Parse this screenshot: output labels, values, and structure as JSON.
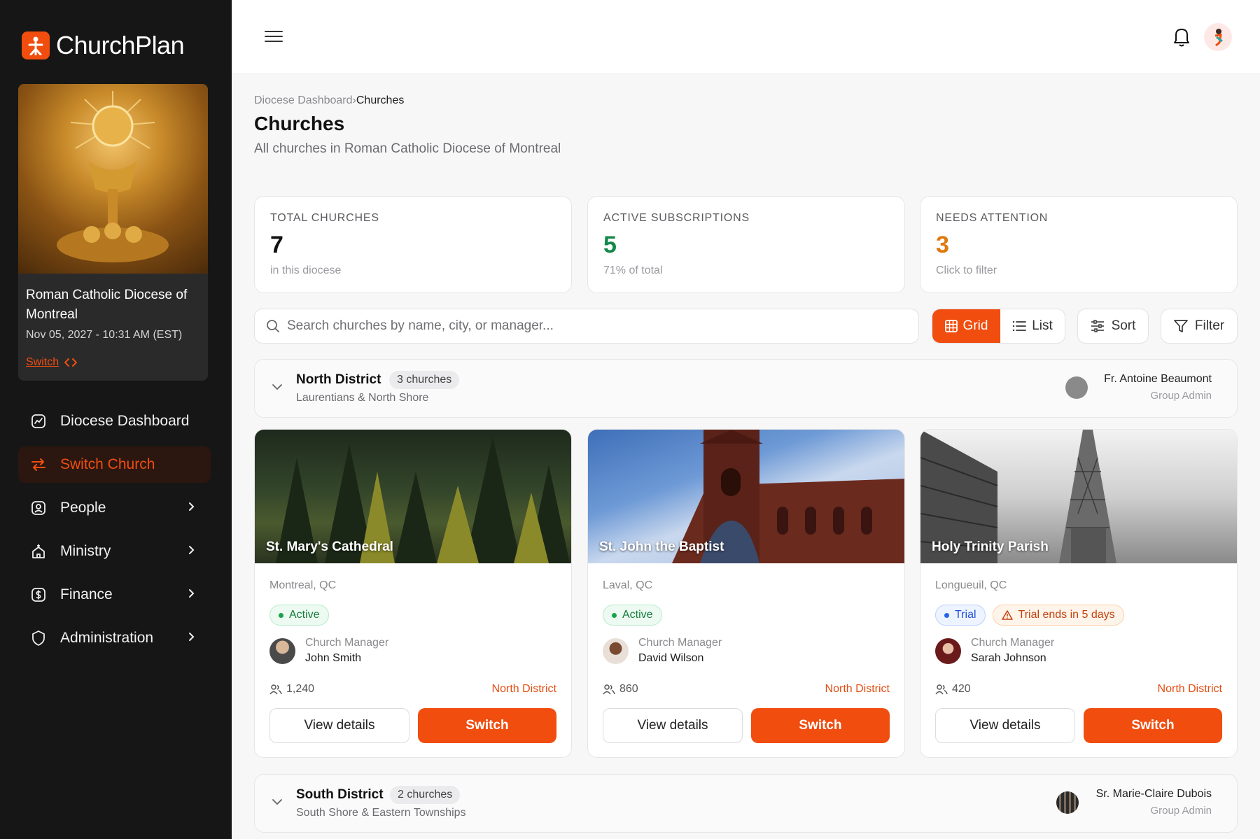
{
  "app": {
    "name": "ChurchPlan"
  },
  "diocese": {
    "name": "Roman Catholic Diocese of Montreal",
    "datetime": "Nov 05, 2027 - 10:31 AM (EST)",
    "switch_label": "Switch"
  },
  "nav": {
    "items": [
      {
        "label": "Diocese Dashboard",
        "icon": "chart-icon"
      },
      {
        "label": "Switch Church",
        "icon": "swap-icon",
        "active": true
      },
      {
        "label": "People",
        "icon": "user-icon"
      },
      {
        "label": "Ministry",
        "icon": "church-icon"
      },
      {
        "label": "Finance",
        "icon": "dollar-icon"
      },
      {
        "label": "Administration",
        "icon": "shield-icon"
      }
    ]
  },
  "breadcrumb": {
    "parent": "Diocese Dashboard",
    "separator": "›",
    "current": "Churches"
  },
  "page": {
    "title": "Churches",
    "subtitle": "All churches in Roman Catholic Diocese of Montreal"
  },
  "stats": [
    {
      "label": "TOTAL CHURCHES",
      "value": "7",
      "note": "in this diocese",
      "color": "#111111"
    },
    {
      "label": "ACTIVE SUBSCRIPTIONS",
      "value": "5",
      "note": "71% of total",
      "color": "#16884a"
    },
    {
      "label": "NEEDS ATTENTION",
      "value": "3",
      "note": "Click to filter",
      "color": "#e0790e"
    }
  ],
  "search": {
    "placeholder": "Search churches by name, city, or manager..."
  },
  "toolbar": {
    "grid": "Grid",
    "list": "List",
    "sort": "Sort",
    "filter": "Filter"
  },
  "districts": [
    {
      "name": "North District",
      "count": "3 churches",
      "subtitle": "Laurentians & North Shore",
      "admin_name": "Fr. Antoine Beaumont",
      "admin_role": "Group Admin"
    },
    {
      "name": "South District",
      "count": "2 churches",
      "subtitle": "South Shore & Eastern Townships",
      "admin_name": "Sr. Marie-Claire Dubois",
      "admin_role": "Group Admin"
    }
  ],
  "churches": [
    {
      "name": "St. Mary's Cathedral",
      "city": "Montreal, QC",
      "status": "Active",
      "manager_role": "Church Manager",
      "manager": "John Smith",
      "members": "1,240",
      "district": "North District",
      "view": "View details",
      "switch": "Switch"
    },
    {
      "name": "St. John the Baptist",
      "city": "Laval, QC",
      "status": "Active",
      "manager_role": "Church Manager",
      "manager": "David Wilson",
      "members": "860",
      "district": "North District",
      "view": "View details",
      "switch": "Switch"
    },
    {
      "name": "Holy Trinity Parish",
      "city": "Longueuil, QC",
      "status": "Trial",
      "warning": "Trial ends in 5 days",
      "manager_role": "Church Manager",
      "manager": "Sarah Johnson",
      "members": "420",
      "district": "North District",
      "view": "View details",
      "switch": "Switch"
    }
  ],
  "colors": {
    "accent": "#f04d0f",
    "sidebar": "#161616"
  }
}
